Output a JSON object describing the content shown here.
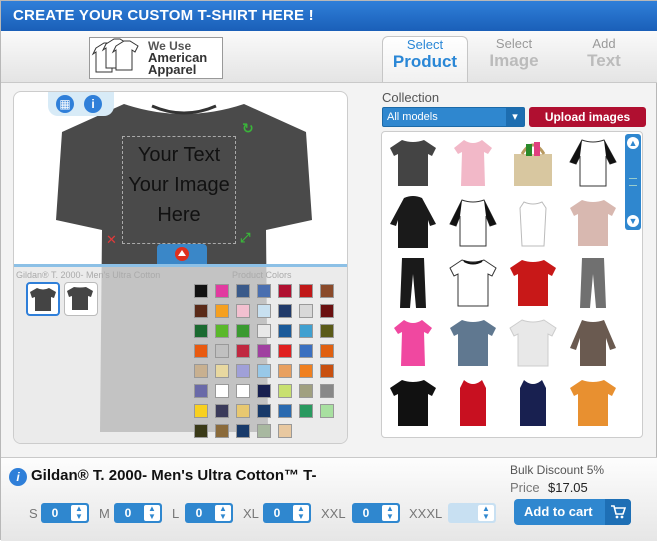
{
  "title": "CREATE YOUR CUSTOM T-SHIRT HERE !",
  "logo": {
    "line1": "We Use",
    "line2": "American",
    "line3": "Apparel"
  },
  "steps": [
    {
      "small": "Select",
      "big": "Product"
    },
    {
      "small": "Select",
      "big": "Image"
    },
    {
      "small": "Add",
      "big": "Text"
    }
  ],
  "design": {
    "text_lines": [
      "Your Text",
      "Your Image",
      "Here"
    ],
    "product_label": "Gildan® T. 2000- Men's Ultra Cotton",
    "colors_label": "Product Colors",
    "swatch_colors": [
      "#111111",
      "#e23aa0",
      "#3a5a8a",
      "#4a6fb0",
      "#b01030",
      "#c01818",
      "#8a4a2a",
      "#5a2a18",
      "#f5a020",
      "#f2c0d0",
      "#c8e0f0",
      "#203a6a",
      "#d8d8d8",
      "#6a1010",
      "#1a6a30",
      "#5ab82a",
      "#3a9a30",
      "#e8e8e8",
      "#1a5a9a",
      "#40a0d0",
      "#5a5a18",
      "#e85a10",
      "#c0c0c0",
      "#c02840",
      "#a040a0",
      "#e02020",
      "#3a70c0",
      "#e06010",
      "#c8b090",
      "#e8d8a0",
      "#a0a0d8",
      "#98c8e8",
      "#e8a060",
      "#f08020",
      "#c85010",
      "#6a6aa8",
      "#ffffff",
      "#ffffff",
      "#182050",
      "#c8e070",
      "#a0a080",
      "#888888",
      "#f8d020",
      "#3a3a5a",
      "#e8c870",
      "#183a6a",
      "#2a6ab0",
      "#2a9a60",
      "#a8e0a0",
      "#3a3a18",
      "#8a6a3a",
      "#183a6a",
      "#a8b8a0",
      "#e8c8a0"
    ]
  },
  "collection": {
    "label": "Collection",
    "selected": "All models",
    "upload_label": "Upload images"
  },
  "footer": {
    "product_name": "Gildan® T. 2000- Men's Ultra Cotton™ T-",
    "bulk": "Bulk Discount 5%",
    "price_label": "Price",
    "price": "$17.05",
    "sizes": [
      {
        "label": "S",
        "value": "0"
      },
      {
        "label": "M",
        "value": "0"
      },
      {
        "label": "L",
        "value": "0"
      },
      {
        "label": "XL",
        "value": "0"
      },
      {
        "label": "XXL",
        "value": "0"
      },
      {
        "label": "XXXL",
        "value": ""
      }
    ],
    "cart_label": "Add to cart"
  },
  "colors": {
    "brand_blue": "#2f87cf",
    "upload_red": "#b00f30"
  }
}
